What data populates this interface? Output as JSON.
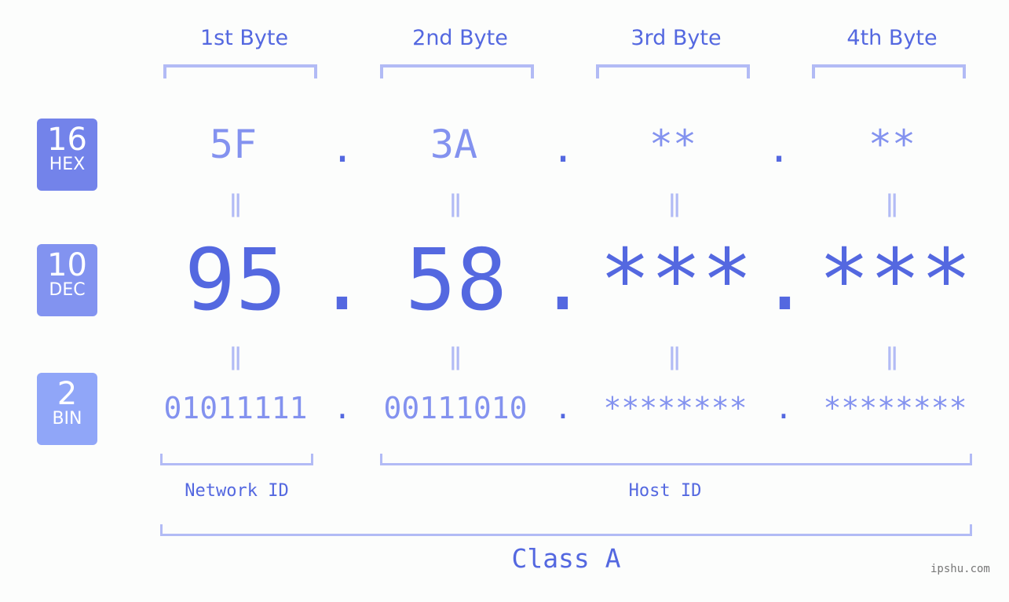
{
  "columns": [
    "1st Byte",
    "2nd Byte",
    "3rd Byte",
    "4th Byte"
  ],
  "bases": [
    {
      "num": "16",
      "name": "HEX",
      "color": "#7383ea"
    },
    {
      "num": "10",
      "name": "DEC",
      "color": "#8293f0"
    },
    {
      "num": "2",
      "name": "BIN",
      "color": "#90a6f8"
    }
  ],
  "hex": [
    "5F",
    "3A",
    "**",
    "**"
  ],
  "dec": [
    "95",
    "58",
    "***",
    "***"
  ],
  "bin": [
    "01011111",
    "00111010",
    "********",
    "********"
  ],
  "separator": ".",
  "equals": "=",
  "network_label": "Network ID",
  "host_label": "Host ID",
  "class_label": "Class A",
  "watermark": "ipshu.com"
}
